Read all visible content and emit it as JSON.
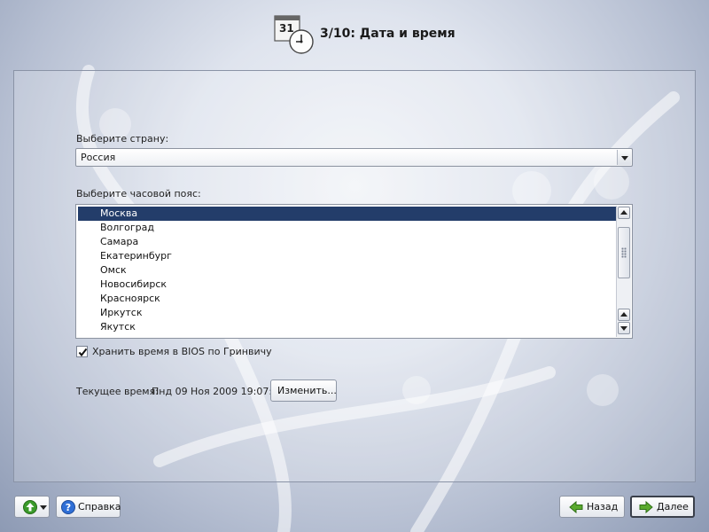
{
  "header": {
    "title": "3/10: Дата и время",
    "icon": "calendar-clock-icon",
    "calendar_day": "31"
  },
  "country": {
    "label": "Выберите страну:",
    "selected": "Россия"
  },
  "timezone": {
    "label": "Выберите часовой пояс:",
    "items": [
      "Москва",
      "Волгоград",
      "Самара",
      "Екатеринбург",
      "Омск",
      "Новосибирск",
      "Красноярск",
      "Иркутск",
      "Якутск"
    ],
    "selected_index": 0
  },
  "bios": {
    "label": "Хранить время в BIOS по Гринвичу",
    "checked": true
  },
  "current_time": {
    "label": "Текущее время:",
    "value": "Пнд 09 Ноя 2009 19:07:32",
    "change_label": "Изменить..."
  },
  "footer": {
    "menu_icon": "green-up-arrow-icon",
    "help_label": "Справка",
    "back_label": "Назад",
    "next_label": "Далее"
  },
  "colors": {
    "selection": "#233d6a",
    "accent_green": "#3a9a2a",
    "help_blue": "#2f6fd6"
  }
}
